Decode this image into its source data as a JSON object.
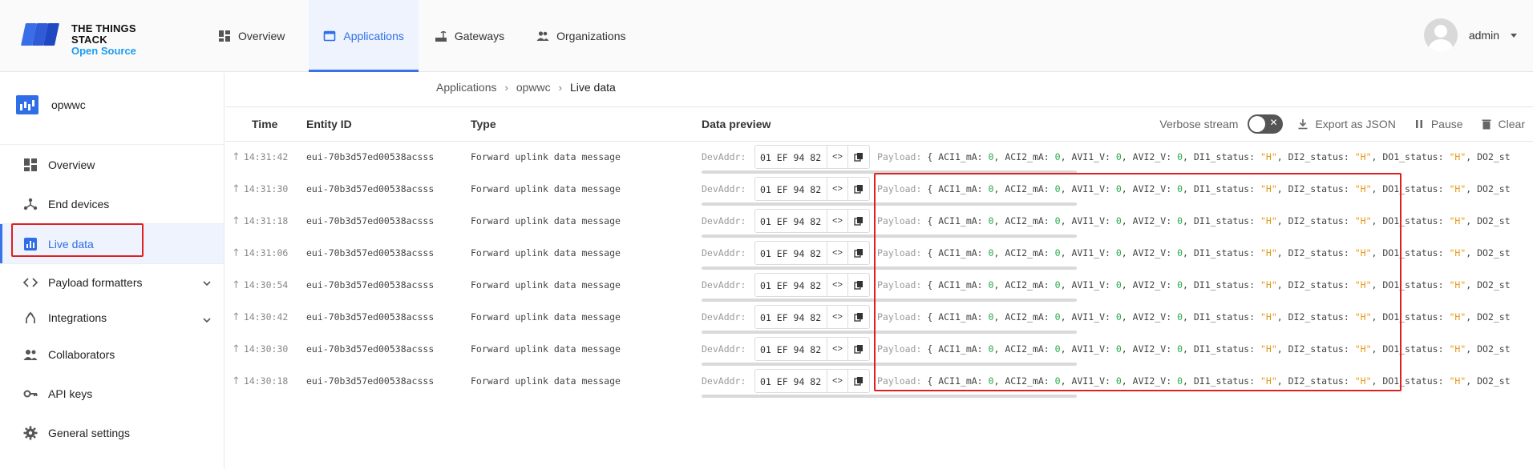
{
  "brand": {
    "line1": "THE THINGS STACK",
    "line2": "Open Source"
  },
  "nav": [
    {
      "label": "Overview",
      "icon": "dashboard-icon"
    },
    {
      "label": "Applications",
      "icon": "application-icon",
      "active": true
    },
    {
      "label": "Gateways",
      "icon": "gateway-icon"
    },
    {
      "label": "Organizations",
      "icon": "organization-icon"
    }
  ],
  "user": {
    "name": "admin"
  },
  "app": {
    "name": "opwwc"
  },
  "sidebar": {
    "items": [
      {
        "label": "Overview",
        "icon": "dashboard-icon"
      },
      {
        "label": "End devices",
        "icon": "device-icon"
      },
      {
        "label": "Live data",
        "icon": "live-data-icon",
        "active": true
      },
      {
        "label": "Payload formatters",
        "icon": "code-icon",
        "expandable": true
      },
      {
        "label": "Integrations",
        "icon": "integration-icon",
        "expandable": true
      },
      {
        "label": "Collaborators",
        "icon": "people-icon"
      },
      {
        "label": "API keys",
        "icon": "key-icon"
      },
      {
        "label": "General settings",
        "icon": "gear-icon"
      }
    ]
  },
  "breadcrumb": [
    "Applications",
    "opwwc",
    "Live data"
  ],
  "table": {
    "headers": {
      "time": "Time",
      "entity": "Entity ID",
      "type": "Type",
      "preview": "Data preview"
    },
    "tools": {
      "verbose": "Verbose stream",
      "export": "Export as JSON",
      "pause": "Pause",
      "clear": "Clear"
    },
    "rows": [
      {
        "time": "14:31:42",
        "entity": "eui-70b3d57ed00538acsss",
        "type": "Forward uplink data message",
        "devaddr_label": "DevAddr:",
        "devaddr": "01 EF 94 82"
      },
      {
        "time": "14:31:30",
        "entity": "eui-70b3d57ed00538acsss",
        "type": "Forward uplink data message",
        "devaddr_label": "DevAddr:",
        "devaddr": "01 EF 94 82"
      },
      {
        "time": "14:31:18",
        "entity": "eui-70b3d57ed00538acsss",
        "type": "Forward uplink data message",
        "devaddr_label": "DevAddr:",
        "devaddr": "01 EF 94 82"
      },
      {
        "time": "14:31:06",
        "entity": "eui-70b3d57ed00538acsss",
        "type": "Forward uplink data message",
        "devaddr_label": "DevAddr:",
        "devaddr": "01 EF 94 82"
      },
      {
        "time": "14:30:54",
        "entity": "eui-70b3d57ed00538acsss",
        "type": "Forward uplink data message",
        "devaddr_label": "DevAddr:",
        "devaddr": "01 EF 94 82"
      },
      {
        "time": "14:30:42",
        "entity": "eui-70b3d57ed00538acsss",
        "type": "Forward uplink data message",
        "devaddr_label": "DevAddr:",
        "devaddr": "01 EF 94 82"
      },
      {
        "time": "14:30:30",
        "entity": "eui-70b3d57ed00538acsss",
        "type": "Forward uplink data message",
        "devaddr_label": "DevAddr:",
        "devaddr": "01 EF 94 82"
      },
      {
        "time": "14:30:18",
        "entity": "eui-70b3d57ed00538acsss",
        "type": "Forward uplink data message",
        "devaddr_label": "DevAddr:",
        "devaddr": "01 EF 94 82"
      }
    ],
    "payload": {
      "label": "Payload:",
      "open": "{",
      "fields": [
        {
          "key": "ACI1_mA:",
          "value": "0",
          "kind": "num"
        },
        {
          "key": "ACI2_mA:",
          "value": "0",
          "kind": "num"
        },
        {
          "key": "AVI1_V:",
          "value": "0",
          "kind": "num"
        },
        {
          "key": "AVI2_V:",
          "value": "0",
          "kind": "num"
        },
        {
          "key": "DI1_status:",
          "value": "\"H\"",
          "kind": "str"
        },
        {
          "key": "DI2_status:",
          "value": "\"H\"",
          "kind": "str"
        },
        {
          "key": "DO1_status:",
          "value": "\"H\"",
          "kind": "str"
        },
        {
          "key": "DO2_st",
          "value": "",
          "kind": "cut"
        }
      ]
    }
  },
  "colors": {
    "accent": "#2f6ee6",
    "highlight": "#e02020",
    "number": "#2aa84a",
    "string": "#e8971a"
  }
}
